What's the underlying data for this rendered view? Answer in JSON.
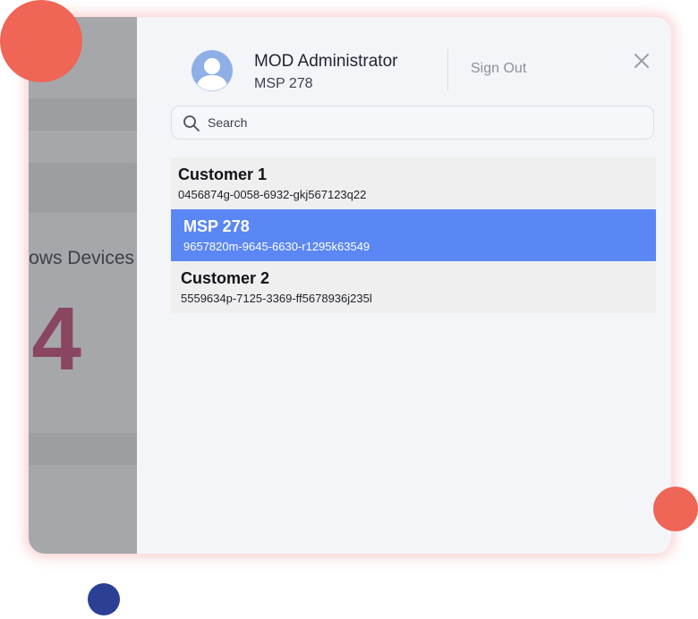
{
  "background_app": {
    "label": "ows Devices",
    "number": "4"
  },
  "header": {
    "user_name": "MOD Administrator",
    "user_org": "MSP 278",
    "sign_out_label": "Sign Out",
    "avatar_icon": "user-avatar-icon",
    "close_icon": "close-icon"
  },
  "search": {
    "placeholder": "Search",
    "value": "",
    "icon": "search-icon"
  },
  "customers": [
    {
      "name": "Customer 1",
      "id": "0456874g-0058-6932-gkj567123q22",
      "selected": false
    },
    {
      "name": "MSP 278",
      "id": "9657820m-9645-6630-r1295k63549",
      "selected": true
    },
    {
      "name": "Customer 2",
      "id": "5559634p-7125-3369-ff5678936j235l",
      "selected": false
    }
  ],
  "colors": {
    "accent_selected": "#5b87f5",
    "decor_coral": "#ef6556",
    "decor_navy": "#2b3f94",
    "background_number": "#8a4561"
  }
}
